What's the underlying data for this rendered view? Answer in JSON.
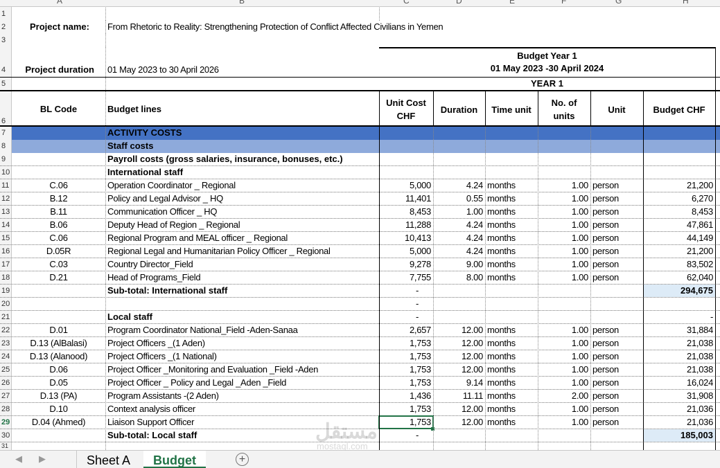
{
  "columns": [
    "A",
    "B",
    "C",
    "D",
    "E",
    "F",
    "G",
    "H"
  ],
  "meta": {
    "project_name_label": "Project name:",
    "project_name": "From Rhetoric to Reality: Strengthening Protection of Conflict Affected Civilians in Yemen",
    "duration_label": "Project duration",
    "duration": "01 May 2023 to 30 April 2026",
    "budget_year_line1": "Budget Year 1",
    "budget_year_line2": "01 May 2023 -30 April 2024",
    "year_label": "YEAR 1"
  },
  "headers": {
    "bl_code": "BL Code",
    "budget_lines": "Budget lines",
    "unit_cost_1": "Unit Cost",
    "unit_cost_2": "CHF",
    "duration": "Duration",
    "time_unit": "Time unit",
    "no_units_1": "No. of",
    "no_units_2": "units",
    "unit": "Unit",
    "budget_chf": "Budget CHF"
  },
  "sections": {
    "activity_costs": "ACTIVITY COSTS",
    "staff_costs": "Staff costs",
    "payroll": "Payroll costs (gross salaries, insurance, bonuses, etc.)",
    "international_staff": "International staff",
    "local_staff": "Local staff"
  },
  "international_rows": [
    {
      "rn": "11",
      "code": "C.06",
      "line": "Operation Coordinator _ Regional",
      "cost": "5,000",
      "dur": "4.24",
      "tu": "months",
      "units": "1.00",
      "unit": "person",
      "budget": "21,200"
    },
    {
      "rn": "12",
      "code": "B.12",
      "line": "Policy and Legal Advisor _ HQ",
      "cost": "11,401",
      "dur": "0.55",
      "tu": "months",
      "units": "1.00",
      "unit": "person",
      "budget": "6,270"
    },
    {
      "rn": "13",
      "code": "B.11",
      "line": "Communication Officer _ HQ",
      "cost": "8,453",
      "dur": "1.00",
      "tu": "months",
      "units": "1.00",
      "unit": "person",
      "budget": "8,453"
    },
    {
      "rn": "14",
      "code": "B.06",
      "line": "Deputy Head of Region _ Regional",
      "cost": "11,288",
      "dur": "4.24",
      "tu": "months",
      "units": "1.00",
      "unit": "person",
      "budget": "47,861"
    },
    {
      "rn": "15",
      "code": "C.06",
      "line": "Regional Program and MEAL officer  _ Regional",
      "cost": "10,413",
      "dur": "4.24",
      "tu": "months",
      "units": "1.00",
      "unit": "person",
      "budget": "44,149"
    },
    {
      "rn": "16",
      "code": "D.05R",
      "line": "Regional Legal and Humanitarian Policy Officer  _ Regional",
      "cost": "5,000",
      "dur": "4.24",
      "tu": "months",
      "units": "1.00",
      "unit": "person",
      "budget": "21,200"
    },
    {
      "rn": "17",
      "code": "C.03",
      "line": "Country Director_Field",
      "cost": "9,278",
      "dur": "9.00",
      "tu": "months",
      "units": "1.00",
      "unit": "person",
      "budget": "83,502"
    },
    {
      "rn": "18",
      "code": "D.21",
      "line": "Head of Programs_Field",
      "cost": "7,755",
      "dur": "8.00",
      "tu": "months",
      "units": "1.00",
      "unit": "person",
      "budget": "62,040"
    }
  ],
  "intl_subtotal": {
    "label": "Sub-total: International staff",
    "cost": "-",
    "budget": "294,675"
  },
  "blank_dash": "-",
  "local_rows": [
    {
      "rn": "22",
      "code": "D.01",
      "line": "Program Coordinator National_Field -Aden-Sanaa",
      "cost": "2,657",
      "dur": "12.00",
      "tu": "months",
      "units": "1.00",
      "unit": "person",
      "budget": "31,884"
    },
    {
      "rn": "23",
      "code": "D.13 (AlBalasi)",
      "line": "Project Officers _(1 Aden)",
      "cost": "1,753",
      "dur": "12.00",
      "tu": "months",
      "units": "1.00",
      "unit": "person",
      "budget": "21,038"
    },
    {
      "rn": "24",
      "code": "D.13 (Alanood)",
      "line": "Project Officers _(1 National)",
      "cost": "1,753",
      "dur": "12.00",
      "tu": "months",
      "units": "1.00",
      "unit": "person",
      "budget": "21,038"
    },
    {
      "rn": "25",
      "code": "D.06",
      "line": "Project Officer _Monitoring and Evaluation _Field -Aden",
      "cost": "1,753",
      "dur": "12.00",
      "tu": "months",
      "units": "1.00",
      "unit": "person",
      "budget": "21,038"
    },
    {
      "rn": "26",
      "code": "D.05",
      "line": "Project Officer _ Policy and Legal _Aden _Field",
      "cost": "1,753",
      "dur": "9.14",
      "tu": "months",
      "units": "1.00",
      "unit": "person",
      "budget": "16,024"
    },
    {
      "rn": "27",
      "code": "D.13 (PA)",
      "line": "Program Assistants -(2 Aden)",
      "cost": "1,436",
      "dur": "11.11",
      "tu": "months",
      "units": "2.00",
      "unit": "person",
      "budget": "31,908"
    },
    {
      "rn": "28",
      "code": "D.10",
      "line": "Context analysis officer",
      "cost": "1,753",
      "dur": "12.00",
      "tu": "months",
      "units": "1.00",
      "unit": "person",
      "budget": "21,036"
    },
    {
      "rn": "29",
      "code": "D.04 (Ahmed)",
      "line": "Liaison Support Officer",
      "cost": "1,753",
      "dur": "12.00",
      "tu": "months",
      "units": "1.00",
      "unit": "person",
      "budget": "21,036"
    }
  ],
  "local_subtotal": {
    "label": "Sub-total: Local staff",
    "cost": "-",
    "budget": "185,003"
  },
  "row_numbers": {
    "r1": "1",
    "r2": "2",
    "r3": "3",
    "r4": "4",
    "r5": "5",
    "r6": "6",
    "r7": "7",
    "r8": "8",
    "r9": "9",
    "r10": "10",
    "r19": "19",
    "r20": "20",
    "r21": "21",
    "r30": "30",
    "r31": "31"
  },
  "tabs": {
    "sheet_a": "Sheet A",
    "budget": "Budget",
    "add": "+"
  },
  "watermark": {
    "main": "مستقل",
    "sub": "mostaql.com"
  },
  "colors": {
    "accent": "#217346",
    "band_dark": "#4472c4",
    "band_light": "#8eaadb",
    "subtotal": "#ddebf7"
  }
}
